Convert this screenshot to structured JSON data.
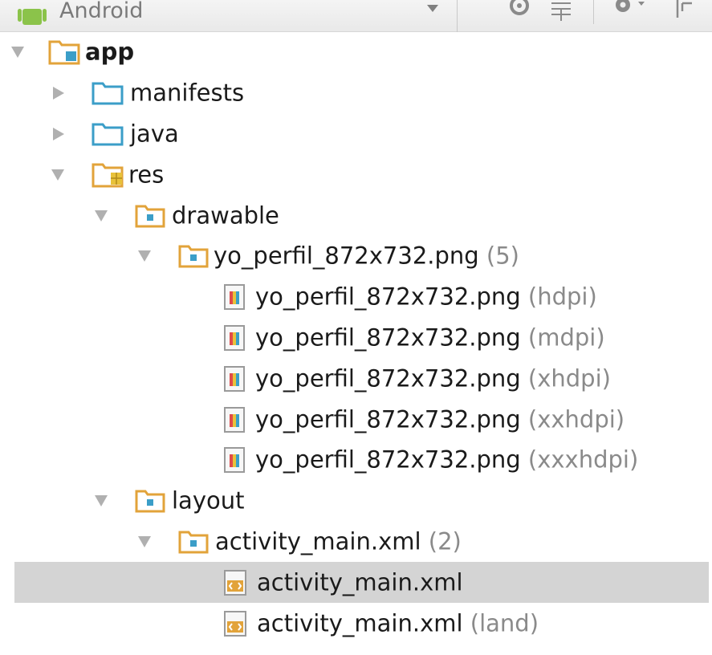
{
  "toolbar": {
    "view_label": "Android",
    "icons": [
      "android-icon",
      "dropdown-arrow-icon",
      "sync-icon",
      "collapse-all-icon",
      "gear-icon",
      "hide-panel-icon"
    ]
  },
  "tree": [
    {
      "label": "app",
      "qualifier": "",
      "icon": "module-folder-icon",
      "expanded": true
    },
    {
      "label": "manifests",
      "qualifier": "",
      "icon": "folder-icon",
      "expanded": false
    },
    {
      "label": "java",
      "qualifier": "",
      "icon": "folder-icon",
      "expanded": false
    },
    {
      "label": "res",
      "qualifier": "",
      "icon": "resource-folder-icon",
      "expanded": true
    },
    {
      "label": "drawable",
      "qualifier": "",
      "icon": "package-folder-icon",
      "expanded": true
    },
    {
      "label": "yo_perfil_872x732.png",
      "qualifier": "(5)",
      "icon": "package-folder-icon",
      "expanded": true
    },
    {
      "label": "yo_perfil_872x732.png",
      "qualifier": "(hdpi)",
      "icon": "image-file-icon"
    },
    {
      "label": "yo_perfil_872x732.png",
      "qualifier": "(mdpi)",
      "icon": "image-file-icon"
    },
    {
      "label": "yo_perfil_872x732.png",
      "qualifier": "(xhdpi)",
      "icon": "image-file-icon"
    },
    {
      "label": "yo_perfil_872x732.png",
      "qualifier": "(xxhdpi)",
      "icon": "image-file-icon"
    },
    {
      "label": "yo_perfil_872x732.png",
      "qualifier": "(xxxhdpi)",
      "icon": "image-file-icon"
    },
    {
      "label": "layout",
      "qualifier": "",
      "icon": "package-folder-icon",
      "expanded": true
    },
    {
      "label": "activity_main.xml",
      "qualifier": "(2)",
      "icon": "package-folder-icon",
      "expanded": true
    },
    {
      "label": "activity_main.xml",
      "qualifier": "",
      "icon": "xml-file-icon",
      "selected": true
    },
    {
      "label": "activity_main.xml",
      "qualifier": "(land)",
      "icon": "xml-file-icon"
    }
  ],
  "colors": {
    "folder_blue": "#3b9ec8",
    "folder_orange": "#e2a33a",
    "selection": "#d4d4d4",
    "qualifier_text": "#8a8a8a"
  }
}
